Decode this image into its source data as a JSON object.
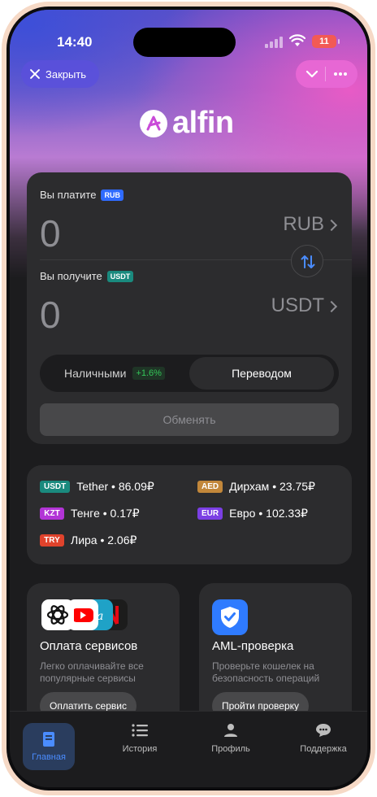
{
  "status_bar": {
    "time": "14:40",
    "battery": "11",
    "battery_color": "#f25a55"
  },
  "top_bar": {
    "close_label": "Закрыть",
    "brand": "alfin"
  },
  "exchange": {
    "pay_label": "Вы платите",
    "pay_tag": "RUB",
    "pay_amount": "0",
    "pay_currency": "RUB",
    "receive_label": "Вы получите",
    "receive_tag": "USDT",
    "receive_amount": "0",
    "receive_currency": "USDT",
    "methods": [
      {
        "label": "Наличными",
        "badge": "+1.6%",
        "selected": false
      },
      {
        "label": "Переводом",
        "selected": true
      }
    ],
    "submit_label": "Обменять"
  },
  "rates": [
    {
      "code": "USDT",
      "text": "Tether • 86.09₽",
      "color": "#1a8a7e"
    },
    {
      "code": "AED",
      "text": "Дирхам • 23.75₽",
      "color": "#c2873a"
    },
    {
      "code": "KZT",
      "text": "Тенге • 0.17₽",
      "color": "#b234d6"
    },
    {
      "code": "EUR",
      "text": "Евро • 102.33₽",
      "color": "#7b3fe4"
    },
    {
      "code": "TRY",
      "text": "Лира • 2.06₽",
      "color": "#e0432c"
    }
  ],
  "services": {
    "title": "Оплата сервисов",
    "description": "Легко оплачивайте все популярные сервисы",
    "button": "Оплатить сервис"
  },
  "aml": {
    "title": "AML-проверка",
    "description": "Проверьте кошелек на безопасность операций",
    "button": "Пройти проверку"
  },
  "tabs": [
    {
      "label": "Главная",
      "icon": "home-card-icon",
      "active": true
    },
    {
      "label": "История",
      "icon": "list-icon"
    },
    {
      "label": "Профиль",
      "icon": "person-icon"
    },
    {
      "label": "Поддержка",
      "icon": "chat-bubble-icon"
    }
  ],
  "colors": {
    "accent": "#4a8cff",
    "card": "#2c2c2e",
    "background": "#1c1c1e"
  }
}
